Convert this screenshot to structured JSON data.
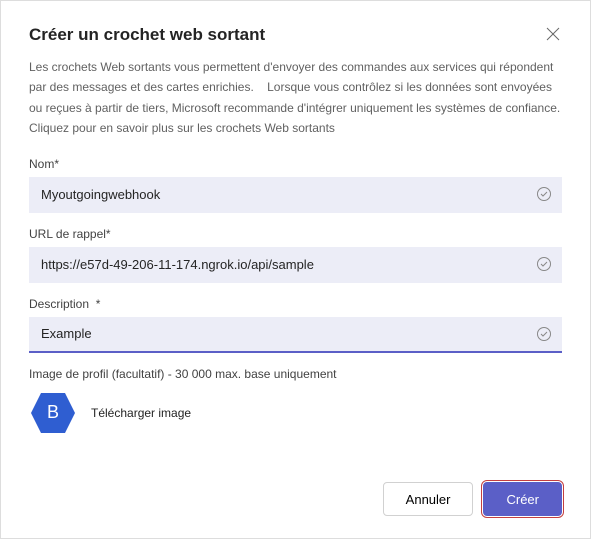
{
  "title": "Créer un crochet web sortant",
  "intro": "Les crochets Web sortants vous permettent d'envoyer des commandes aux services qui répondent par des messages et des cartes enrichies.    Lorsque vous contrôlez si les données sont envoyées ou reçues à partir de tiers, Microsoft recommande d'intégrer uniquement les systèmes de confiance. Cliquez pour en savoir plus sur les crochets Web sortants",
  "fields": {
    "name": {
      "label": "Nom*",
      "value": "Myoutgoingwebhook"
    },
    "callback": {
      "label": "URL de rappel*",
      "value": "https://e57d-49-206-11-174.ngrok.io/api/sample"
    },
    "description": {
      "label": "Description  *",
      "value": "Example"
    }
  },
  "profile": {
    "label": "Image de profil (facultatif) - 30 000 max. base uniquement",
    "avatar_letter": "B",
    "upload_label": "Télécharger image"
  },
  "buttons": {
    "cancel": "Annuler",
    "create": "Créer"
  }
}
